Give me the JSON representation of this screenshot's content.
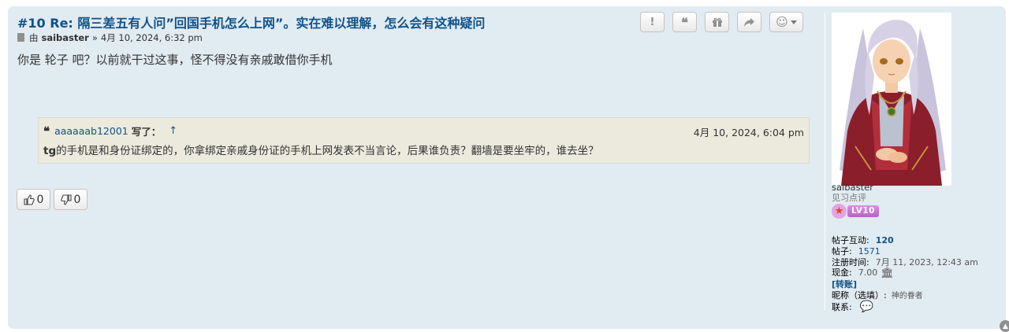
{
  "post": {
    "title": "#10 Re: 隔三差五有人问”回国手机怎么上网”。实在难以理解，怎么会有这种疑问",
    "by_label": "由",
    "author": "saibaster",
    "separator": "»",
    "date": "4月 10, 2024, 6:32 pm",
    "content": "你是 轮子 吧？以前就干过这事，怪不得没有亲戚敢借你手机"
  },
  "buttons": {
    "report": "!",
    "quote": "❝",
    "gift": "🎁",
    "share": "➦",
    "reactions": "☺"
  },
  "quote": {
    "author": "aaaaaab12001",
    "wrote": "写了：",
    "up_arrow": "↑",
    "date": "4月 10, 2024, 6:04 pm",
    "body_tg": "tg",
    "body_rest": "的手机是和身份证绑定的，你拿绑定亲戚身份证的手机上网发表不当言论，后果谁负责？翻墙是要坐牢的，谁去坐？"
  },
  "reactions": {
    "like_count": "0",
    "dislike_count": "0"
  },
  "profile": {
    "username": "saibaster",
    "rank": "见习点评",
    "level_badge": "LV10",
    "interactions_label": "帖子互动:",
    "interactions_value": "120",
    "posts_label": "帖子:",
    "posts_value": "1571",
    "joined_label": "注册时间:",
    "joined_value": "7月 11, 2023, 12:43 am",
    "cash_label": "现金:",
    "cash_value": "7.00",
    "transfer_label": "[转账]",
    "nickname_label": "昵称（选填）:",
    "nickname_value": "神的眷者",
    "contact_label": "联系:"
  },
  "colors": {
    "post_bg": "#e1ebf2",
    "link": "#105289",
    "quote_bg": "#ebeadd"
  }
}
